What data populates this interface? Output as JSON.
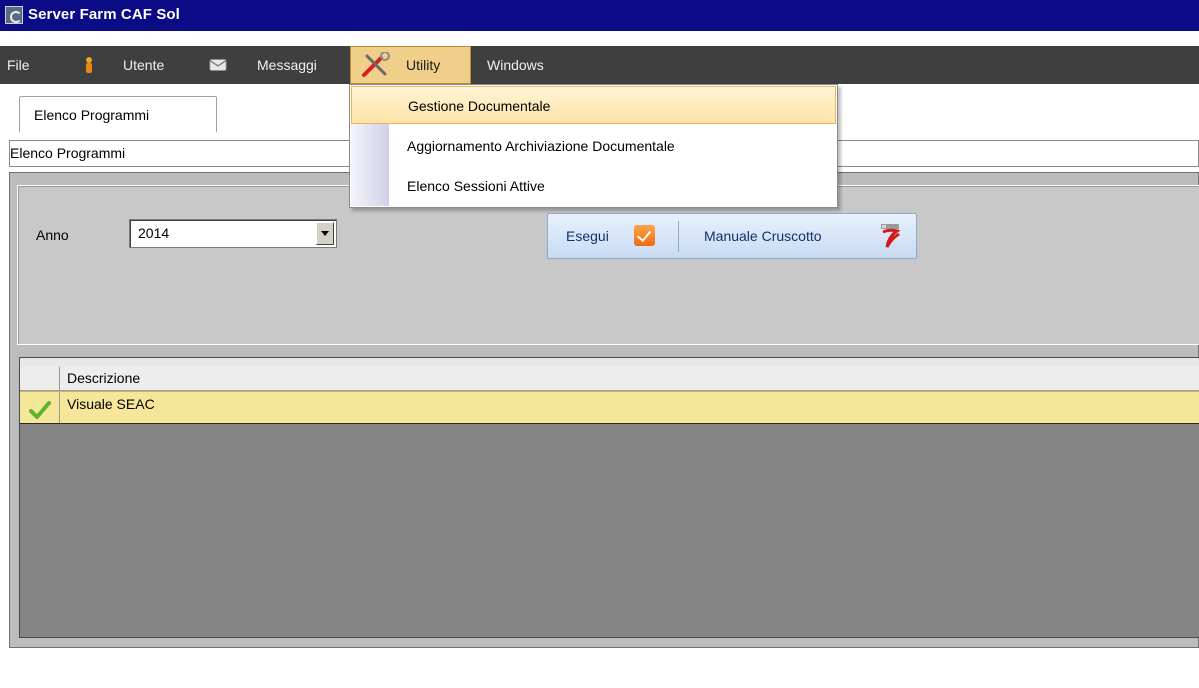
{
  "window": {
    "title": "Server Farm CAF Sol"
  },
  "menu": {
    "items": [
      {
        "label": "File",
        "icon": ""
      },
      {
        "label": "Utente",
        "icon": "user-icon"
      },
      {
        "label": "Messaggi",
        "icon": "envelope-icon"
      },
      {
        "label": "Utility",
        "icon": "tools-icon"
      },
      {
        "label": "Windows",
        "icon": ""
      }
    ],
    "active": "Utility",
    "dropdown": {
      "items": [
        {
          "label": "Gestione Documentale",
          "highlighted": true
        },
        {
          "label": "Aggiornamento Archiviazione Documentale",
          "highlighted": false
        },
        {
          "label": "Elenco Sessioni Attive",
          "highlighted": false
        }
      ]
    }
  },
  "tab": {
    "label": "Elenco Programmi"
  },
  "subheader": {
    "text": "Elenco Programmi"
  },
  "filters": {
    "anno_label": "Anno",
    "anno_value": "2014"
  },
  "actions": {
    "esegui_label": "Esegui",
    "manuale_label": "Manuale Cruscotto"
  },
  "grid": {
    "columns": [
      "Descrizione"
    ],
    "rows": [
      {
        "descrizione": "Visuale SEAC",
        "status": "check-icon"
      }
    ]
  },
  "colors": {
    "titlebar": "#0b0b86",
    "menubar": "#3f3f3f",
    "menu_active": "#f0cf8a",
    "row_selected": "#f6e69a",
    "grid_bg": "#858585",
    "panel_bg": "#bcbcbc"
  }
}
